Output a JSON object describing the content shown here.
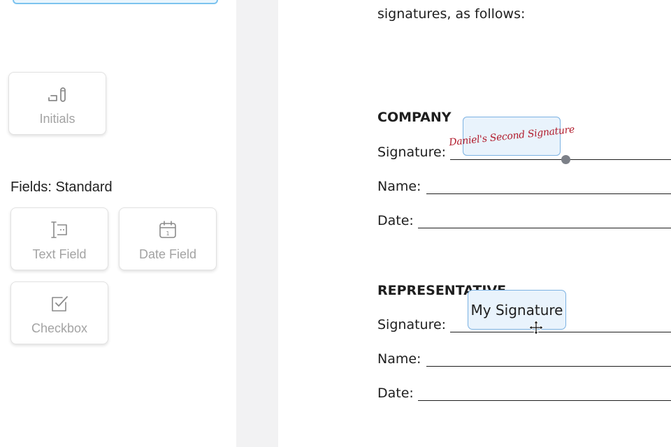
{
  "left_panel": {
    "initials_label": "Initials",
    "fields_heading": "Fields: Standard",
    "fields": [
      {
        "label": "Text Field",
        "icon": "text-field-icon"
      },
      {
        "label": "Date Field",
        "icon": "calendar-icon"
      },
      {
        "label": "Checkbox",
        "icon": "checkbox-icon"
      }
    ]
  },
  "document": {
    "intro": "signatures, as follows:",
    "company": {
      "heading": "COMPANY",
      "signature_label": "Signature:",
      "name_label": "Name:",
      "date_label": "Date:",
      "placed_signature": "Daniel's Second Signature"
    },
    "representative": {
      "heading": "REPRESENTATIVE",
      "signature_label": "Signature:",
      "name_label": "Name:",
      "date_label": "Date:",
      "placed_signature": "My Signature"
    }
  },
  "colors": {
    "field_border": "#7cb2e2",
    "field_bg": "#e9f3fc",
    "signature_ink": "#b11b2c",
    "label_gray": "#a3a3a3"
  }
}
